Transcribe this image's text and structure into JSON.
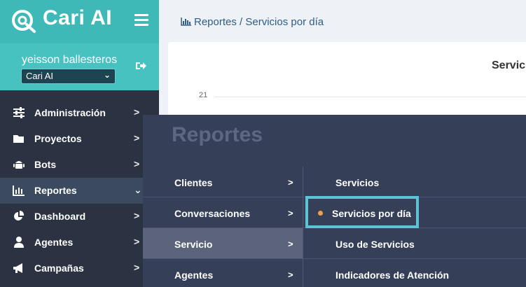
{
  "brand": {
    "name": "Cari AI"
  },
  "user": {
    "name": "yeisson ballesteros",
    "company": "Cari AI"
  },
  "nav": {
    "items": [
      {
        "label": "Administración",
        "icon": "sliders-icon",
        "arrow": ">"
      },
      {
        "label": "Proyectos",
        "icon": "folder-icon",
        "arrow": ">"
      },
      {
        "label": "Bots",
        "icon": "android-icon",
        "arrow": ">"
      },
      {
        "label": "Reportes",
        "icon": "bar-chart-icon",
        "arrow": "⌄"
      },
      {
        "label": "Dashboard",
        "icon": "pie-chart-icon",
        "arrow": ">"
      },
      {
        "label": "Agentes",
        "icon": "user-icon",
        "arrow": ">"
      },
      {
        "label": "Campañas",
        "icon": "megaphone-icon",
        "arrow": ">"
      }
    ]
  },
  "breadcrumb": {
    "text": "Reportes / Servicios por día"
  },
  "card": {
    "title": "Servicios",
    "y_tick": "21"
  },
  "mega_menu": {
    "title": "Reportes",
    "categories": [
      {
        "label": "Clientes",
        "arrow": ">"
      },
      {
        "label": "Conversaciones",
        "arrow": ">"
      },
      {
        "label": "Servicio",
        "arrow": ">"
      },
      {
        "label": "Agentes",
        "arrow": ">"
      }
    ],
    "subitems": [
      {
        "label": "Servicios"
      },
      {
        "label": "Servicios por día"
      },
      {
        "label": "Uso de Servicios"
      },
      {
        "label": "Indicadores de Atención"
      }
    ]
  },
  "colors": {
    "brand_teal": "#3fb9b8",
    "sidebar_bg": "#2b3342",
    "mega_bg": "#363f58",
    "highlight": "#5bc3d4",
    "current_dot": "#f0a048"
  }
}
